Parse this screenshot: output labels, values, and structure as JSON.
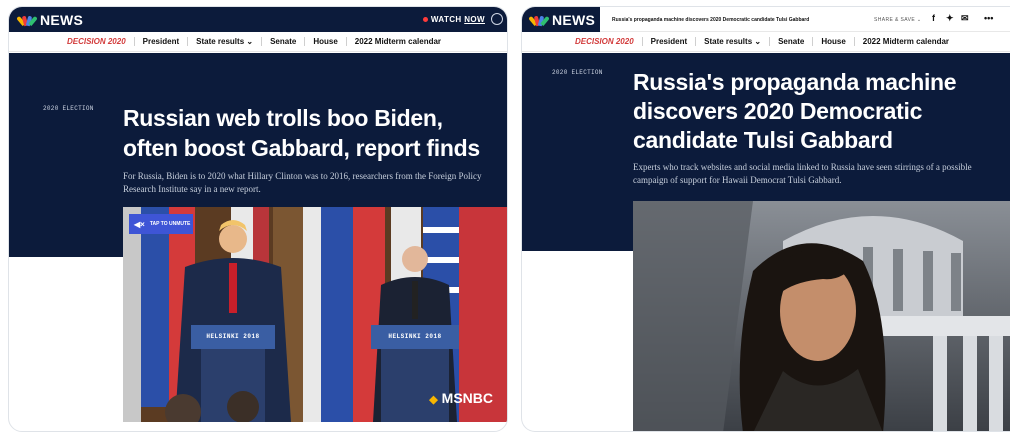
{
  "left": {
    "logo": "NEWS",
    "watch_label": "WATCH",
    "watch_now": "NOW",
    "nav": {
      "decision": "DECISION 2020",
      "items": [
        "President",
        "State results ⌄",
        "Senate",
        "House",
        "2022 Midterm calendar"
      ]
    },
    "tag": "2020 ELECTION",
    "headline": "Russian web trolls boo Biden, often boost Gabbard, report finds",
    "dek": "For Russia, Biden is to 2020 what Hillary Clinton was to 2016, researchers from the Foreign Policy Research Institute say in a new report.",
    "video": {
      "unmute_label": "TAP TO UNMUTE",
      "podium_left": "HELSINKI 2018",
      "podium_right": "HELSINKI 2018",
      "network": "MSNBC"
    }
  },
  "right": {
    "logo": "NEWS",
    "page_title": "Russia's propaganda machine discovers 2020 Democratic candidate Tulsi Gabbard",
    "share_label": "SHARE & SAVE ⌄",
    "nav": {
      "decision": "DECISION 2020",
      "items": [
        "President",
        "State results ⌄",
        "Senate",
        "House",
        "2022 Midterm calendar"
      ]
    },
    "tag": "2020 ELECTION",
    "headline": "Russia's propaganda machine discovers 2020 Democratic candidate Tulsi Gabbard",
    "dek": "Experts who track websites and social media linked to Russia have seen stirrings of a possible campaign of support for Hawaii Democrat Tulsi Gabbard."
  },
  "colors": {
    "navy": "#0c1b3b",
    "accent_red": "#d23b3b",
    "accent_blue": "#2b57c6",
    "unmute_blue": "#3e55d6"
  }
}
